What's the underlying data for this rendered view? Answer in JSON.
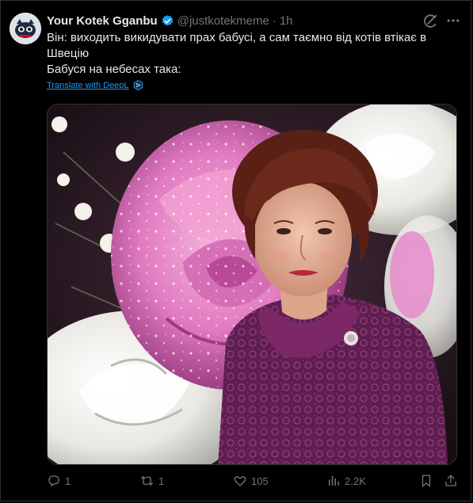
{
  "author": {
    "name": "Your Kotek Gganbu",
    "handle": "@justkotekmeme",
    "separator": "·",
    "time": "1h"
  },
  "post": {
    "lines": [
      "Він: виходить викидувати прах бабусі, а сам таємно від котів втікає в Швецію",
      "Бабуся на небесах така:"
    ],
    "translate_label": "Translate with DeepL"
  },
  "stats": {
    "replies": "1",
    "reposts": "1",
    "likes": "105",
    "views": "2.2K"
  },
  "icons": {
    "verified": "verified-badge-icon",
    "grok": "grok-icon",
    "more": "more-icon",
    "translate": "deepl-icon",
    "reply": "reply-icon",
    "repost": "repost-icon",
    "like": "heart-icon",
    "views": "views-icon",
    "bookmark": "bookmark-icon",
    "share": "share-icon"
  },
  "colors": {
    "background": "#000000",
    "text": "#e7e9ea",
    "muted": "#71767b",
    "link": "#1d9bf0",
    "border": "#2f3336"
  }
}
